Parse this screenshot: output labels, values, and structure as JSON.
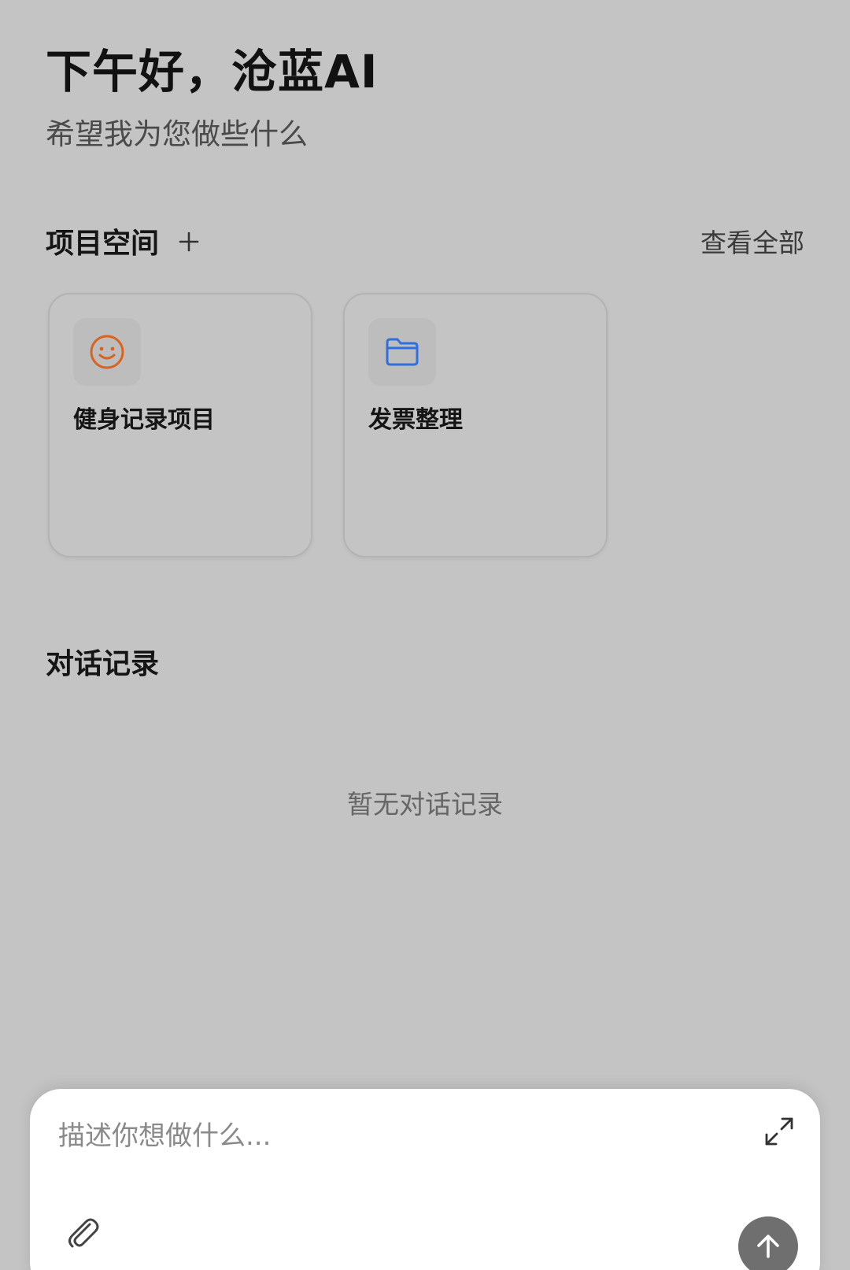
{
  "header": {
    "greeting": "下午好，沧蓝AI",
    "subtitle": "希望我为您做些什么"
  },
  "projects": {
    "title": "项目空间",
    "add_icon": "plus-icon",
    "view_all_label": "查看全部",
    "items": [
      {
        "label": "健身记录项目",
        "icon": "smiley-icon",
        "icon_color": "#d9631f"
      },
      {
        "label": "发票整理",
        "icon": "folder-icon",
        "icon_color": "#2f6fe0"
      }
    ]
  },
  "history": {
    "title": "对话记录",
    "empty_text": "暂无对话记录"
  },
  "composer": {
    "placeholder": "描述你想做什么...",
    "value": "",
    "expand_icon": "expand-icon",
    "attach_icon": "paperclip-icon",
    "send_icon": "arrow-up-icon"
  },
  "colors": {
    "background": "#c4c4c4",
    "composer_bg": "#ffffff",
    "send_button": "#6f6f6f"
  }
}
